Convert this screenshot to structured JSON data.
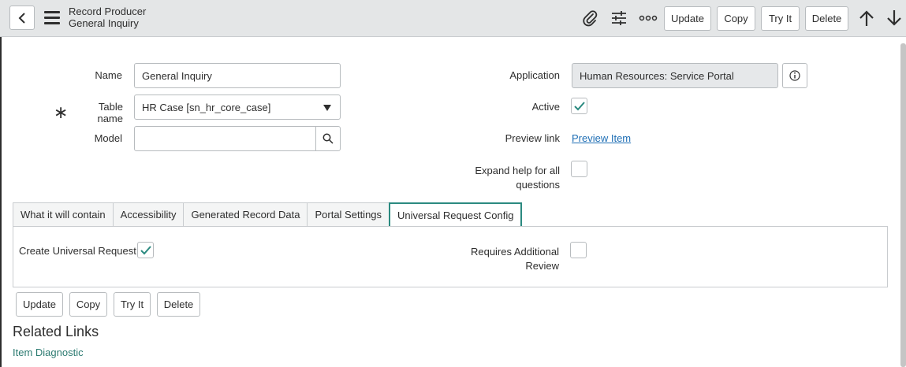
{
  "header": {
    "title": "Record Producer",
    "subtitle": "General Inquiry",
    "buttons": {
      "update": "Update",
      "copy": "Copy",
      "try_it": "Try It",
      "delete": "Delete"
    }
  },
  "form": {
    "name_label": "Name",
    "name_value": "General Inquiry",
    "table_label": "Table name",
    "table_value": "HR Case [sn_hr_core_case]",
    "model_label": "Model",
    "model_value": "",
    "application_label": "Application",
    "application_value": "Human Resources: Service Portal",
    "active_label": "Active",
    "active_checked": true,
    "preview_label": "Preview link",
    "preview_link": "Preview Item",
    "expand_label_line1": "Expand help for all",
    "expand_label_line2": "questions",
    "expand_checked": false
  },
  "tabs": [
    {
      "label": "What it will contain",
      "active": false
    },
    {
      "label": "Accessibility",
      "active": false
    },
    {
      "label": "Generated Record Data",
      "active": false
    },
    {
      "label": "Portal Settings",
      "active": false
    },
    {
      "label": "Universal Request Config",
      "active": true
    }
  ],
  "tab_panel": {
    "create_ur_label": "Create Universal Request",
    "create_ur_checked": true,
    "requires_review_line1": "Requires Additional",
    "requires_review_line2": "Review",
    "requires_review_checked": false
  },
  "footer_buttons": {
    "update": "Update",
    "copy": "Copy",
    "try_it": "Try It",
    "delete": "Delete"
  },
  "related": {
    "title": "Related Links",
    "links": [
      "Item Diagnostic"
    ]
  },
  "colors": {
    "accent": "#2b8a80",
    "link": "#1f6fb5",
    "header_bg": "#e4e6e7"
  }
}
